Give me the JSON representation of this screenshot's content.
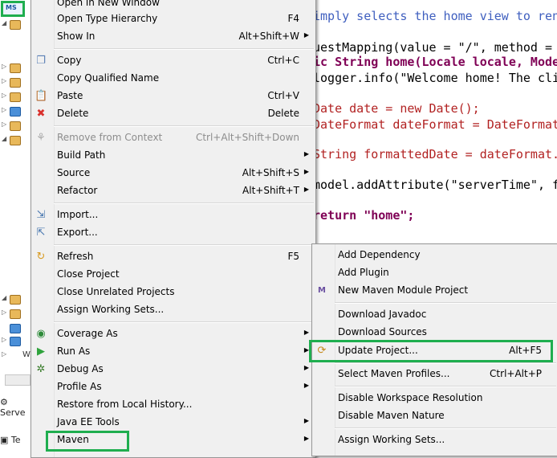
{
  "explorer": {
    "selected_project_badge": "MS",
    "servers_tab": "Serve",
    "terminal_tab": "Te",
    "window_label": "W"
  },
  "editor": {
    "lines": [
      "imply selects the home view to ren",
      "uestMapping(value = \"/\", method = ",
      "ic String home(Locale locale, Mode",
      "logger.info(\"Welcome home! The cli",
      "Date date = new Date();",
      "DateFormat dateFormat = DateFormat",
      "String formattedDate = dateFormat.",
      "model.addAttribute(\"serverTime\", f",
      "return \"home\";"
    ]
  },
  "context_menu": {
    "items": [
      {
        "label": "Open in New Window",
        "shortcut": ""
      },
      {
        "label": "Open Type Hierarchy",
        "shortcut": "F4"
      },
      {
        "label": "Show In",
        "shortcut": "Alt+Shift+W"
      },
      {
        "label": "Copy",
        "shortcut": "Ctrl+C"
      },
      {
        "label": "Copy Qualified Name",
        "shortcut": ""
      },
      {
        "label": "Paste",
        "shortcut": "Ctrl+V"
      },
      {
        "label": "Delete",
        "shortcut": "Delete"
      },
      {
        "label": "Remove from Context",
        "shortcut": "Ctrl+Alt+Shift+Down"
      },
      {
        "label": "Build Path",
        "shortcut": ""
      },
      {
        "label": "Source",
        "shortcut": "Alt+Shift+S"
      },
      {
        "label": "Refactor",
        "shortcut": "Alt+Shift+T"
      },
      {
        "label": "Import...",
        "shortcut": ""
      },
      {
        "label": "Export...",
        "shortcut": ""
      },
      {
        "label": "Refresh",
        "shortcut": "F5"
      },
      {
        "label": "Close Project",
        "shortcut": ""
      },
      {
        "label": "Close Unrelated Projects",
        "shortcut": ""
      },
      {
        "label": "Assign Working Sets...",
        "shortcut": ""
      },
      {
        "label": "Coverage As",
        "shortcut": ""
      },
      {
        "label": "Run As",
        "shortcut": ""
      },
      {
        "label": "Debug As",
        "shortcut": ""
      },
      {
        "label": "Profile As",
        "shortcut": ""
      },
      {
        "label": "Restore from Local History...",
        "shortcut": ""
      },
      {
        "label": "Java EE Tools",
        "shortcut": ""
      },
      {
        "label": "Maven",
        "shortcut": ""
      }
    ]
  },
  "maven_submenu": {
    "items": [
      {
        "label": "Add Dependency",
        "shortcut": ""
      },
      {
        "label": "Add Plugin",
        "shortcut": ""
      },
      {
        "label": "New Maven Module Project",
        "shortcut": ""
      },
      {
        "label": "Download Javadoc",
        "shortcut": ""
      },
      {
        "label": "Download Sources",
        "shortcut": ""
      },
      {
        "label": "Update Project...",
        "shortcut": "Alt+F5"
      },
      {
        "label": "Select Maven Profiles...",
        "shortcut": "Ctrl+Alt+P"
      },
      {
        "label": "Disable Workspace Resolution",
        "shortcut": ""
      },
      {
        "label": "Disable Maven Nature",
        "shortcut": ""
      },
      {
        "label": "Assign Working Sets...",
        "shortcut": ""
      }
    ]
  },
  "highlight_color": "#1fae4f",
  "icons": [
    "copy-icon",
    "paste-icon",
    "delete-icon",
    "remove-context-icon",
    "import-icon",
    "export-icon",
    "refresh-icon",
    "coverage-icon",
    "run-icon",
    "debug-icon",
    "maven-module-icon",
    "update-project-icon"
  ]
}
